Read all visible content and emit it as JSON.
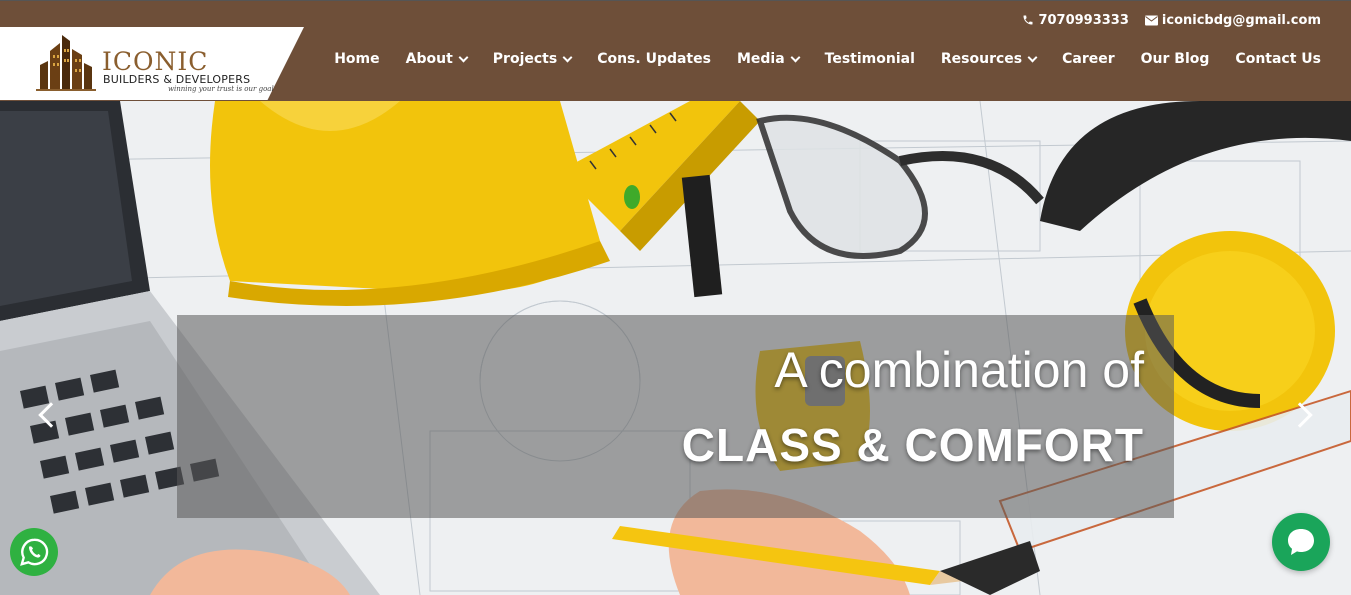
{
  "brand": {
    "name": "ICONIC",
    "subtitle": "BUILDERS & DEVELOPERS",
    "tagline": "winning your trust is our goal",
    "accent": "#6e4f39",
    "logo_gold": "#8a5e2e"
  },
  "topbar": {
    "phone": "7070993333",
    "email": "iconicbdg@gmail.com"
  },
  "nav": {
    "items": [
      {
        "label": "Home"
      },
      {
        "label": "About"
      },
      {
        "label": "Projects"
      },
      {
        "label": "Cons. Updates"
      },
      {
        "label": "Media"
      },
      {
        "label": "Testimonial"
      },
      {
        "label": "Resources"
      },
      {
        "label": "Career"
      },
      {
        "label": "Our Blog"
      },
      {
        "label": "Contact Us"
      }
    ]
  },
  "hero": {
    "line1": "A combination of",
    "line2": "CLASS & COMFORT"
  },
  "icons": {
    "phone": "phone-icon",
    "email": "envelope-icon",
    "dropdown": "chevron-down-icon",
    "prev": "chevron-left-icon",
    "next": "chevron-right-icon",
    "whatsapp": "whatsapp-icon",
    "chat": "chat-bubble-icon"
  }
}
